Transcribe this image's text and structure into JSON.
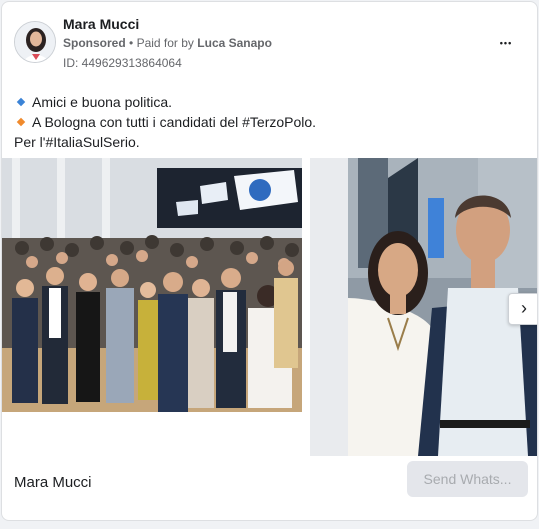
{
  "header": {
    "page_name": "Mara Mucci",
    "sponsored_label": "Sponsored",
    "separator": "•",
    "paid_for_prefix": "Paid for by",
    "payer": "Luca Sanapo",
    "ad_id": "ID: 449629313864064",
    "more_icon": "more-horizontal-icon",
    "more_label": "•••"
  },
  "body": {
    "lines": [
      {
        "text": "Amici e buona politica.",
        "bullet_color": "#3b83d6",
        "icon": "blue-diamond-icon"
      },
      {
        "text": "A Bologna con tutti i candidati del #TerzoPolo.",
        "bullet_color": "#f08a2c",
        "icon": "orange-diamond-icon"
      },
      {
        "text": "Per l'#ItaliaSulSerio."
      }
    ]
  },
  "carousel": {
    "next_icon": "chevron-right-icon",
    "next_glyph": "›"
  },
  "footer": {
    "page_name": "Mara Mucci",
    "cta_label": "Send Whats..."
  },
  "colors": {
    "secondary_text": "#65676b",
    "card_border": "#dddfe2",
    "cta_background": "#e4e6eb",
    "cta_text": "#a8abaf"
  }
}
